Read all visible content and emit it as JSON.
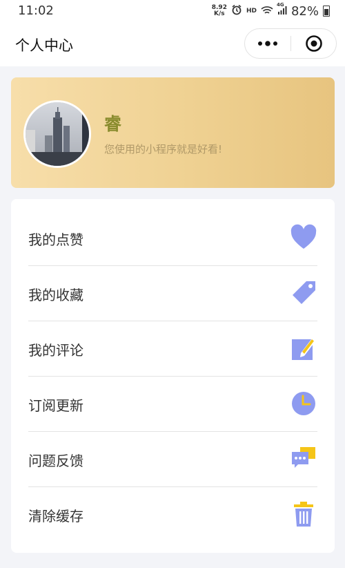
{
  "status_bar": {
    "time": "11:02",
    "net_speed_value": "8.92",
    "net_speed_unit": "K/s",
    "hd_label": "HD",
    "network_label": "4G",
    "battery": "82%"
  },
  "header": {
    "title": "个人中心"
  },
  "profile": {
    "nickname": "睿",
    "motto": "您使用的小程序就是好看!"
  },
  "menu": {
    "items": [
      {
        "label": "我的点赞",
        "icon": "heart-icon"
      },
      {
        "label": "我的收藏",
        "icon": "tag-icon"
      },
      {
        "label": "我的评论",
        "icon": "edit-note-icon"
      },
      {
        "label": "订阅更新",
        "icon": "clock-icon"
      },
      {
        "label": "问题反馈",
        "icon": "chat-bubbles-icon"
      },
      {
        "label": "清除缓存",
        "icon": "trash-icon"
      }
    ]
  },
  "colors": {
    "icon_primary": "#8e9bf0",
    "icon_accent": "#f5c518",
    "card_gradient_start": "#f7deaa",
    "card_gradient_end": "#e7c47f",
    "nickname": "#8a8c2e"
  }
}
